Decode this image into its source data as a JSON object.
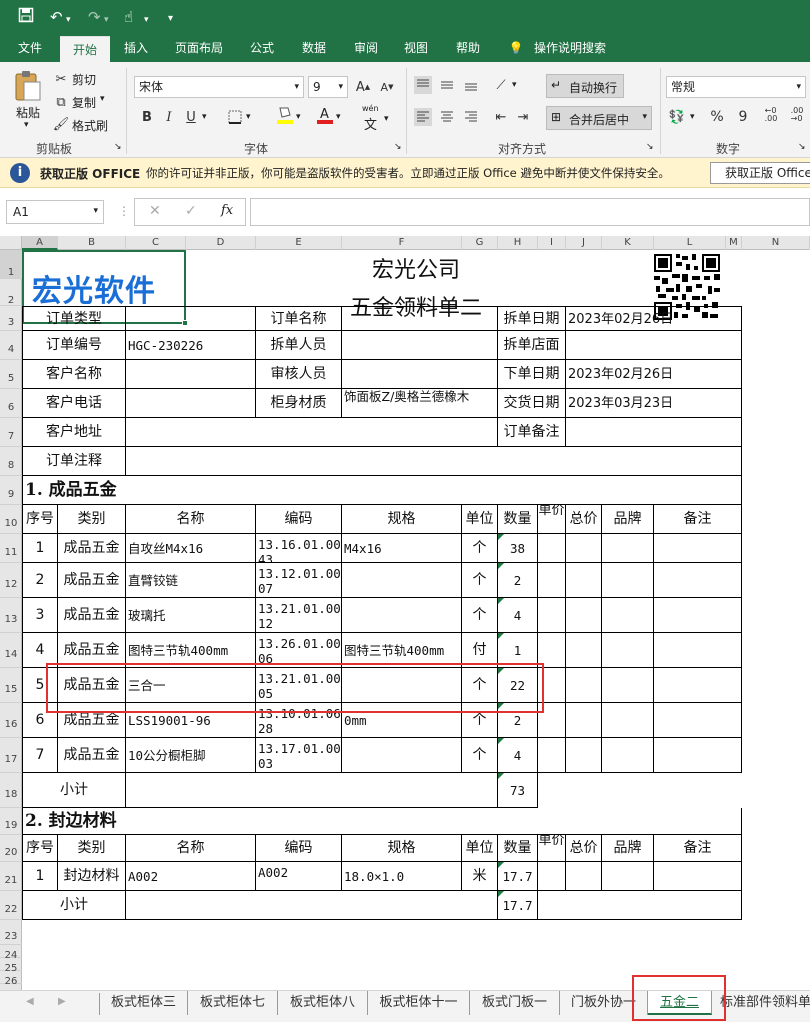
{
  "quick_access": {
    "save_icon": "save-icon",
    "undo_icon": "undo-icon",
    "redo_icon": "redo-icon",
    "touch_icon": "touch-mode-icon",
    "customize": "▾"
  },
  "ribbon_tabs": [
    "文件",
    "开始",
    "插入",
    "页面布局",
    "公式",
    "数据",
    "审阅",
    "视图",
    "帮助",
    "操作说明搜索"
  ],
  "active_tab": "开始",
  "clipboard": {
    "paste": "粘贴",
    "cut": "剪切",
    "copy": "复制",
    "format_painter": "格式刷",
    "group": "剪贴板"
  },
  "font": {
    "name": "宋体",
    "size": "9",
    "bold": "B",
    "italic": "I",
    "underline": "U",
    "group": "字体",
    "wen": "wén",
    "wen_char": "文"
  },
  "alignment": {
    "wrap_text": "自动换行",
    "merge_center": "合并后居中",
    "group": "对齐方式"
  },
  "number": {
    "format": "常规",
    "percent": "%",
    "comma": "9",
    "group": "数字"
  },
  "infobar": {
    "title": "获取正版 OFFICE",
    "message": "你的许可证并非正版，你可能是盗版软件的受害者。立即通过正版 Office 避免中断并使文件保持安全。",
    "button": "获取正版 Office"
  },
  "formula_bar": {
    "name_box": "A1",
    "fx": "fx",
    "value": ""
  },
  "column_headers": [
    "A",
    "B",
    "C",
    "D",
    "E",
    "F",
    "G",
    "H",
    "I",
    "J",
    "K",
    "L",
    "M",
    "N"
  ],
  "row_headers": [
    "1",
    "2",
    "3",
    "4",
    "5",
    "6",
    "7",
    "8",
    "9",
    "10",
    "11",
    "12",
    "13",
    "14",
    "15",
    "16",
    "17",
    "18",
    "19",
    "20",
    "21",
    "22",
    "23",
    "24",
    "25",
    "26"
  ],
  "sheet": {
    "logo_text": "宏光软件",
    "company": "宏光公司",
    "doc_title": "五金领料单二",
    "qr_icon": "qr-code-icon",
    "header_rows": [
      {
        "l1": "订单类型",
        "v1": "",
        "l2": "订单名称",
        "v2": "",
        "l3": "拆单日期",
        "v3": "2023年02月26日"
      },
      {
        "l1": "订单编号",
        "v1": "HGC-230226",
        "l2": "拆单人员",
        "v2": "",
        "l3": "拆单店面",
        "v3": ""
      },
      {
        "l1": "客户名称",
        "v1": "",
        "l2": "审核人员",
        "v2": "",
        "l3": "下单日期",
        "v3": "2023年02月26日"
      },
      {
        "l1": "客户电话",
        "v1": "",
        "l2": "柜身材质",
        "v2": "饰面板Z/奥格兰德橡木",
        "l3": "交货日期",
        "v3": "2023年03月23日"
      }
    ],
    "address_label": "客户地址",
    "address_value": "",
    "order_note_label": "订单备注",
    "order_note_value": "",
    "order_comment_label": "订单注释",
    "order_comment_value": "",
    "section1_title": "1. 成品五金",
    "section2_title": "2. 封边材料",
    "table_headers": [
      "序号",
      "类别",
      "名称",
      "编码",
      "规格",
      "单位",
      "数量",
      "单价",
      "总价",
      "品牌",
      "备注"
    ],
    "section1_rows": [
      {
        "no": "1",
        "cat": "成品五金",
        "name": "自攻丝M4x16",
        "code": "13.16.01.0043",
        "spec": "M4x16",
        "unit": "个",
        "qty": "38"
      },
      {
        "no": "2",
        "cat": "成品五金",
        "name": "直臂铰链",
        "code": "13.12.01.0007",
        "spec": "",
        "unit": "个",
        "qty": "2"
      },
      {
        "no": "3",
        "cat": "成品五金",
        "name": "玻璃托",
        "code": "13.21.01.0012",
        "spec": "",
        "unit": "个",
        "qty": "4"
      },
      {
        "no": "4",
        "cat": "成品五金",
        "name": "图特三节轨400mm",
        "code": "13.26.01.0006",
        "spec": "图特三节轨400mm",
        "unit": "付",
        "qty": "1"
      },
      {
        "no": "5",
        "cat": "成品五金",
        "name": "三合一",
        "code": "13.21.01.0005",
        "spec": "",
        "unit": "个",
        "qty": "22"
      },
      {
        "no": "6",
        "cat": "成品五金",
        "name": "LSS19001-96",
        "code": "13.10.01.0628",
        "spec": "0mm",
        "unit": "个",
        "qty": "2"
      },
      {
        "no": "7",
        "cat": "成品五金",
        "name": "10公分橱柜脚",
        "code": "13.17.01.0003",
        "spec": "",
        "unit": "个",
        "qty": "4"
      }
    ],
    "subtotal_label": "小计",
    "section1_total": "73",
    "section2_rows": [
      {
        "no": "1",
        "cat": "封边材料",
        "name": "A002",
        "code": "A002",
        "spec": "18.0×1.0",
        "unit": "米",
        "qty": "17.7"
      }
    ],
    "section2_total": "17.7"
  },
  "sheet_tabs": [
    "板式柜体三",
    "板式柜体七",
    "板式柜体八",
    "板式柜体十一",
    "板式门板一",
    "门板外协一",
    "五金二",
    "标准部件领料单"
  ],
  "active_sheet": "五金二",
  "colors": {
    "excel_green": "#217346",
    "highlight": "#e03030",
    "info_bg": "#fff4ce",
    "logo_blue": "#1a6fd6"
  }
}
